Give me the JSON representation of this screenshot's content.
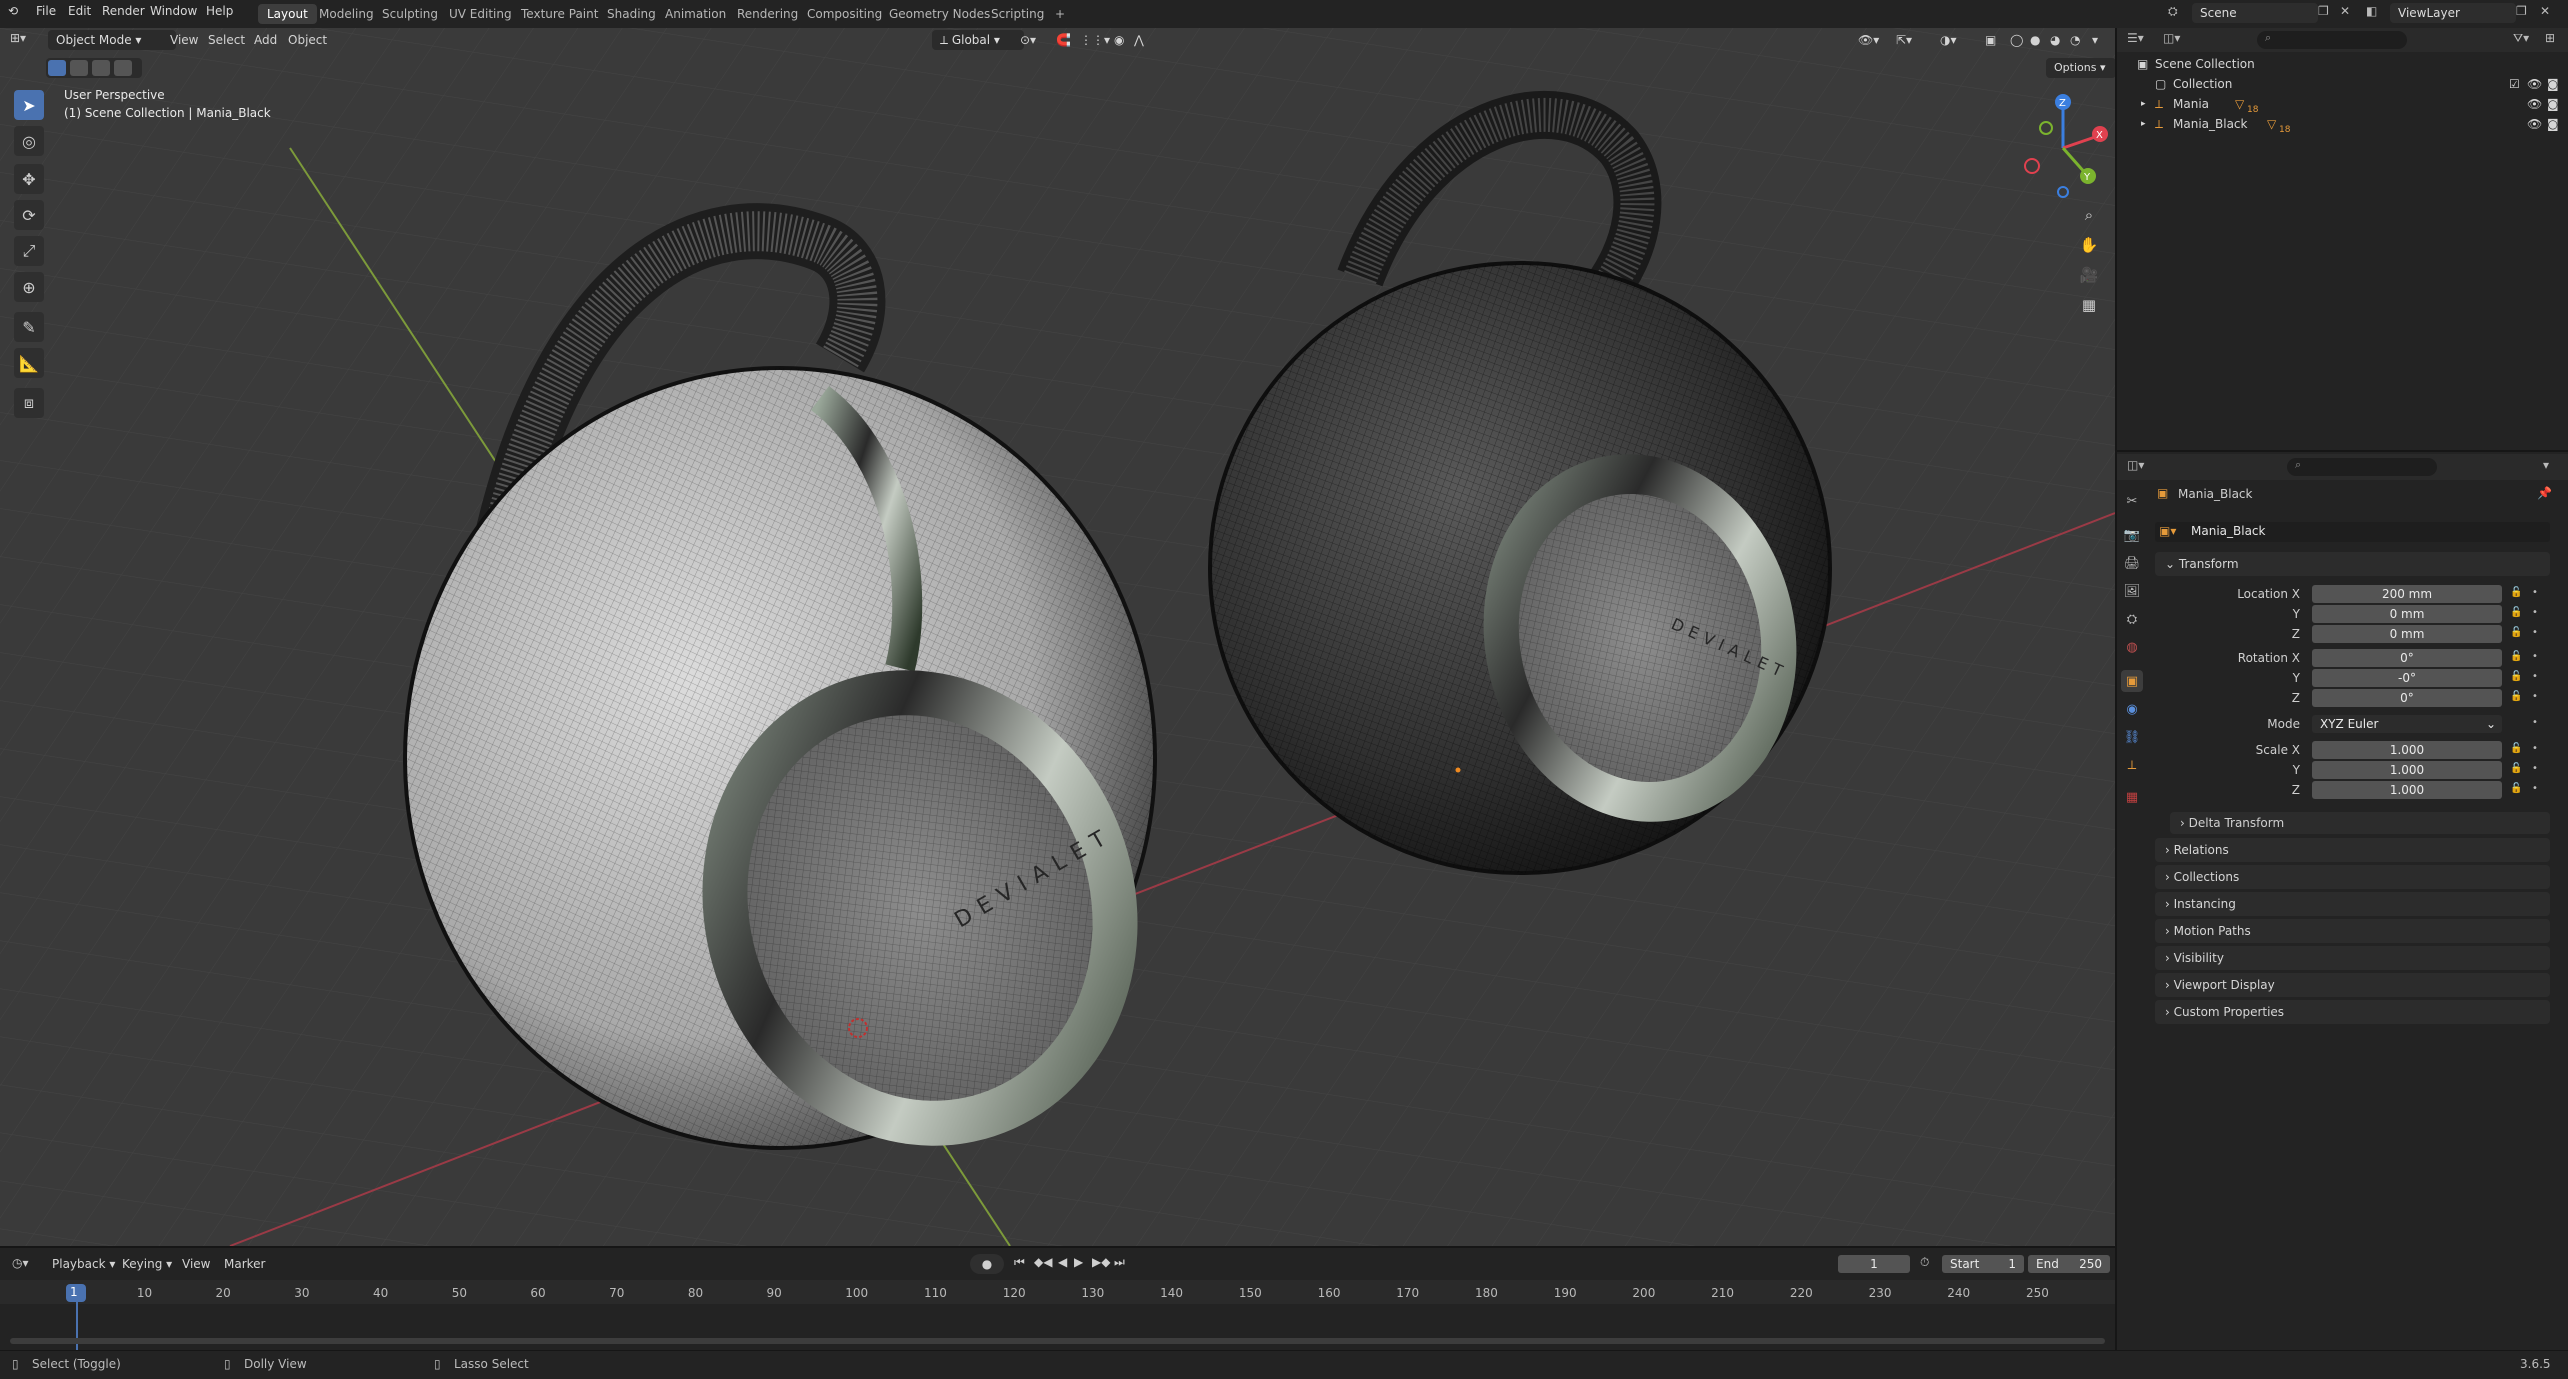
{
  "topbar": {
    "menus": [
      "File",
      "Edit",
      "Render",
      "Window",
      "Help"
    ],
    "workspaces": [
      "Layout",
      "Modeling",
      "Sculpting",
      "UV Editing",
      "Texture Paint",
      "Shading",
      "Animation",
      "Rendering",
      "Compositing",
      "Geometry Nodes",
      "Scripting"
    ],
    "active_workspace": "Layout",
    "add_tab": "+",
    "scene": "Scene",
    "view_layer": "ViewLayer"
  },
  "viewport": {
    "mode": "Object Mode",
    "menus": [
      "View",
      "Select",
      "Add",
      "Object"
    ],
    "orientation": "Global",
    "options_label": "Options",
    "overlay_title": "User Perspective",
    "overlay_subtitle": "(1) Scene Collection | Mania_Black",
    "brand_text": "DEVIALET",
    "gizmo": {
      "x_label": "X",
      "y_label": "Y",
      "z_label": "Z",
      "x_color": "#e0414f",
      "y_color": "#7bb32e",
      "z_color": "#3b7fe0"
    }
  },
  "outliner": {
    "items": [
      {
        "label": "Scene Collection",
        "indent": 0
      },
      {
        "label": "Collection",
        "indent": 1
      },
      {
        "label": "Mania",
        "indent": 1,
        "badge": "18"
      },
      {
        "label": "Mania_Black",
        "indent": 1,
        "badge": "18"
      }
    ]
  },
  "properties": {
    "object_name": "Mania_Black",
    "object_field": "Mania_Black",
    "transform_header": "Transform",
    "location": {
      "label": "Location X",
      "x": "200 mm",
      "y_label": "Y",
      "y": "0 mm",
      "z_label": "Z",
      "z": "0 mm"
    },
    "rotation": {
      "label": "Rotation X",
      "x": "0°",
      "y_label": "Y",
      "y": "-0°",
      "z_label": "Z",
      "z": "0°"
    },
    "mode": {
      "label": "Mode",
      "value": "XYZ Euler"
    },
    "scale": {
      "label": "Scale X",
      "x": "1.000",
      "y_label": "Y",
      "y": "1.000",
      "z_label": "Z",
      "z": "1.000"
    },
    "delta_transform": "Delta Transform",
    "sections": [
      "Relations",
      "Collections",
      "Instancing",
      "Motion Paths",
      "Visibility",
      "Viewport Display",
      "Custom Properties"
    ]
  },
  "timeline": {
    "menus": [
      "Playback",
      "Keying",
      "View",
      "Marker"
    ],
    "current_frame": "1",
    "start_label": "Start",
    "start": "1",
    "end_label": "End",
    "end": "250",
    "ruler": [
      "1",
      "10",
      "20",
      "30",
      "40",
      "50",
      "60",
      "70",
      "80",
      "90",
      "100",
      "110",
      "120",
      "130",
      "140",
      "150",
      "160",
      "170",
      "180",
      "190",
      "200",
      "210",
      "220",
      "230",
      "240",
      "250"
    ]
  },
  "statusbar": {
    "select": "Select (Toggle)",
    "dolly": "Dolly View",
    "lasso": "Lasso Select",
    "version": "3.6.5"
  }
}
